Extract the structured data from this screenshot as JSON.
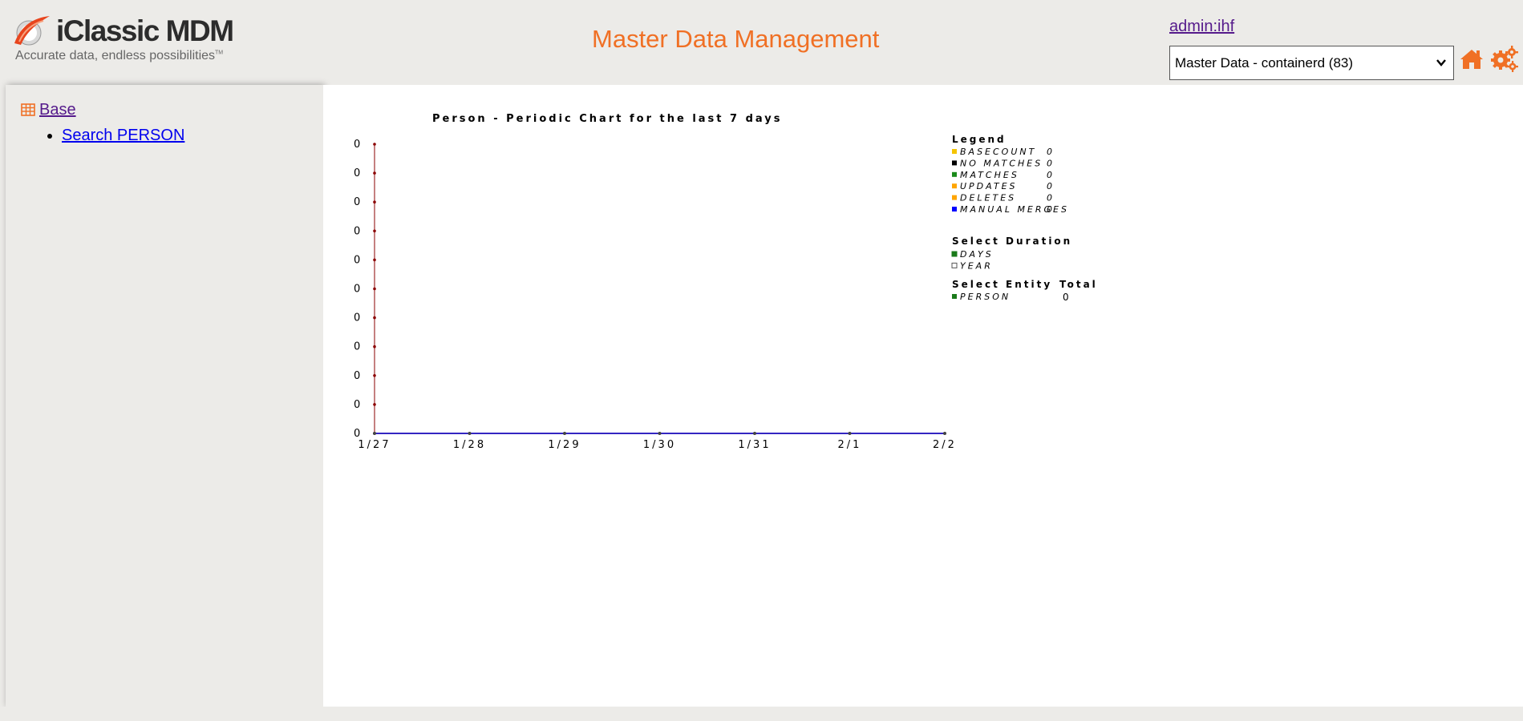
{
  "header": {
    "logo_text": "iClassic MDM",
    "logo_tagline": "Accurate data, endless possibilities",
    "logo_tm": "TM",
    "app_title": "Master Data Management",
    "user": "admin:ihf",
    "context_selected": "Master Data - containerd (83)"
  },
  "sidebar": {
    "section": "Base",
    "items": [
      {
        "label": "Search PERSON"
      }
    ]
  },
  "icons": [
    "table-icon",
    "home-icon",
    "gear-icon",
    "chevron-down-icon"
  ],
  "colors": {
    "accent": "#f07025",
    "basecount": "#f5c400",
    "no_matches": "#000000",
    "matches": "#1a8a1a",
    "updates": "#ffa500",
    "deletes": "#ffa500",
    "manual_merges": "#0000ff",
    "selected": "#1a7a1a"
  },
  "chart_data": {
    "type": "line",
    "title": "Person - Periodic Chart for the last 7 days",
    "categories": [
      "1/27",
      "1/28",
      "1/29",
      "1/30",
      "1/31",
      "2/1",
      "2/2"
    ],
    "y_tick_labels": [
      "0",
      "0",
      "0",
      "0",
      "0",
      "0",
      "0",
      "0",
      "0",
      "0",
      "0"
    ],
    "series": [
      {
        "name": "BASECOUNT",
        "values": [
          0,
          0,
          0,
          0,
          0,
          0,
          0
        ]
      },
      {
        "name": "NO MATCHES",
        "values": [
          0,
          0,
          0,
          0,
          0,
          0,
          0
        ]
      },
      {
        "name": "MATCHES",
        "values": [
          0,
          0,
          0,
          0,
          0,
          0,
          0
        ]
      },
      {
        "name": "UPDATES",
        "values": [
          0,
          0,
          0,
          0,
          0,
          0,
          0
        ]
      },
      {
        "name": "DELETES",
        "values": [
          0,
          0,
          0,
          0,
          0,
          0,
          0
        ]
      },
      {
        "name": "MANUAL MERGES",
        "values": [
          0,
          0,
          0,
          0,
          0,
          0,
          0
        ]
      }
    ],
    "legend_title": "Legend",
    "legend": [
      {
        "name": "BASECOUNT",
        "total": "0"
      },
      {
        "name": "NO MATCHES",
        "total": "0"
      },
      {
        "name": "MATCHES",
        "total": "0"
      },
      {
        "name": "UPDATES",
        "total": "0"
      },
      {
        "name": "DELETES",
        "total": "0"
      },
      {
        "name": "MANUAL MERGES",
        "total": "0"
      }
    ],
    "duration_title": "Select Duration",
    "durations": [
      {
        "label": "DAYS",
        "selected": true
      },
      {
        "label": "YEAR",
        "selected": false
      }
    ],
    "entity_title": "Select Entity",
    "total_title": "Total",
    "entities": [
      {
        "label": "PERSON",
        "total": "0",
        "selected": true
      }
    ]
  }
}
